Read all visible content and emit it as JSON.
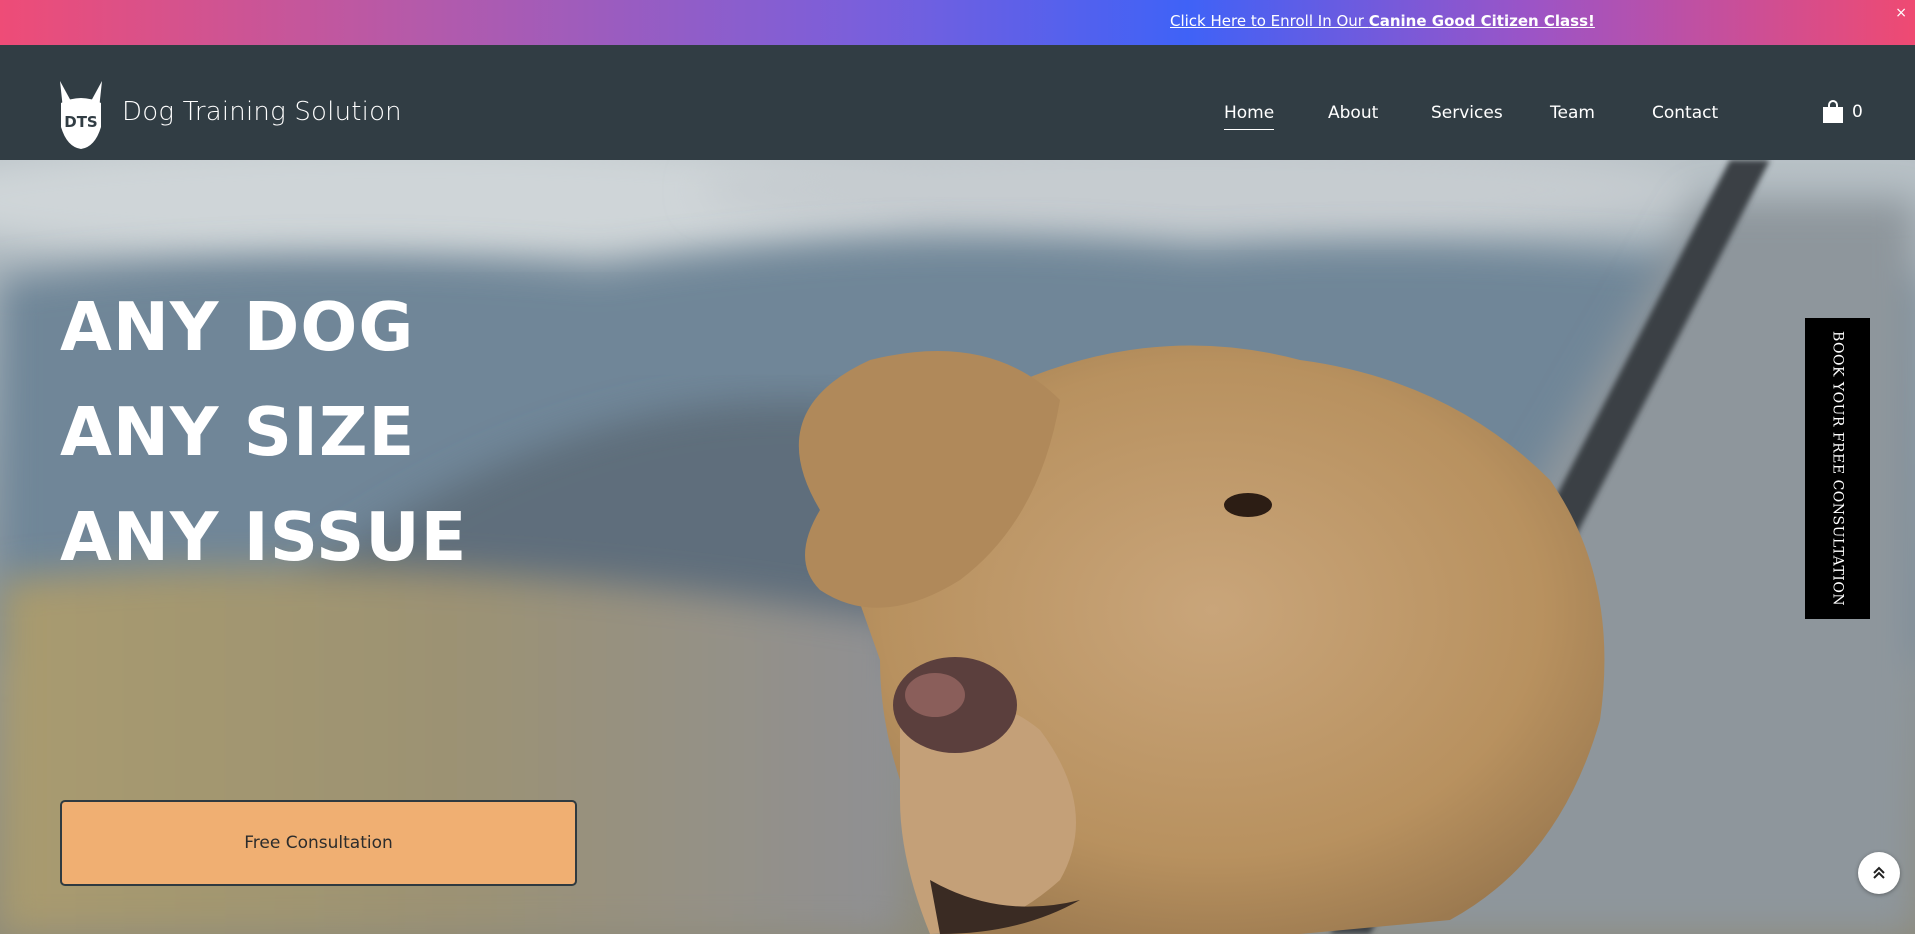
{
  "announcement": {
    "text_prefix": "Click Here to Enroll In Our ",
    "text_bold": "Canine Good Citizen Class!",
    "close_label": "×"
  },
  "header": {
    "logo_text": "DTS",
    "site_title": "Dog Training Solution",
    "nav": [
      {
        "label": "Home",
        "active": true
      },
      {
        "label": "About",
        "active": false
      },
      {
        "label": "Services",
        "active": false
      },
      {
        "label": "Team",
        "active": false
      },
      {
        "label": "Contact",
        "active": false
      }
    ],
    "cart_count": "0",
    "cart_icon": "shopping-bag-icon"
  },
  "hero": {
    "headline": [
      "ANY DOG",
      "ANY SIZE",
      "ANY ISSUE"
    ],
    "cta_label": "Free Consultation",
    "side_tab_label": "BOOK YOUR FREE CONSULTATION",
    "scroll_top_icon": "double-chevron-up-icon"
  },
  "colors": {
    "header_bg": "#313d44",
    "cta_bg": "#f0af72",
    "side_tab_bg": "#000000"
  }
}
